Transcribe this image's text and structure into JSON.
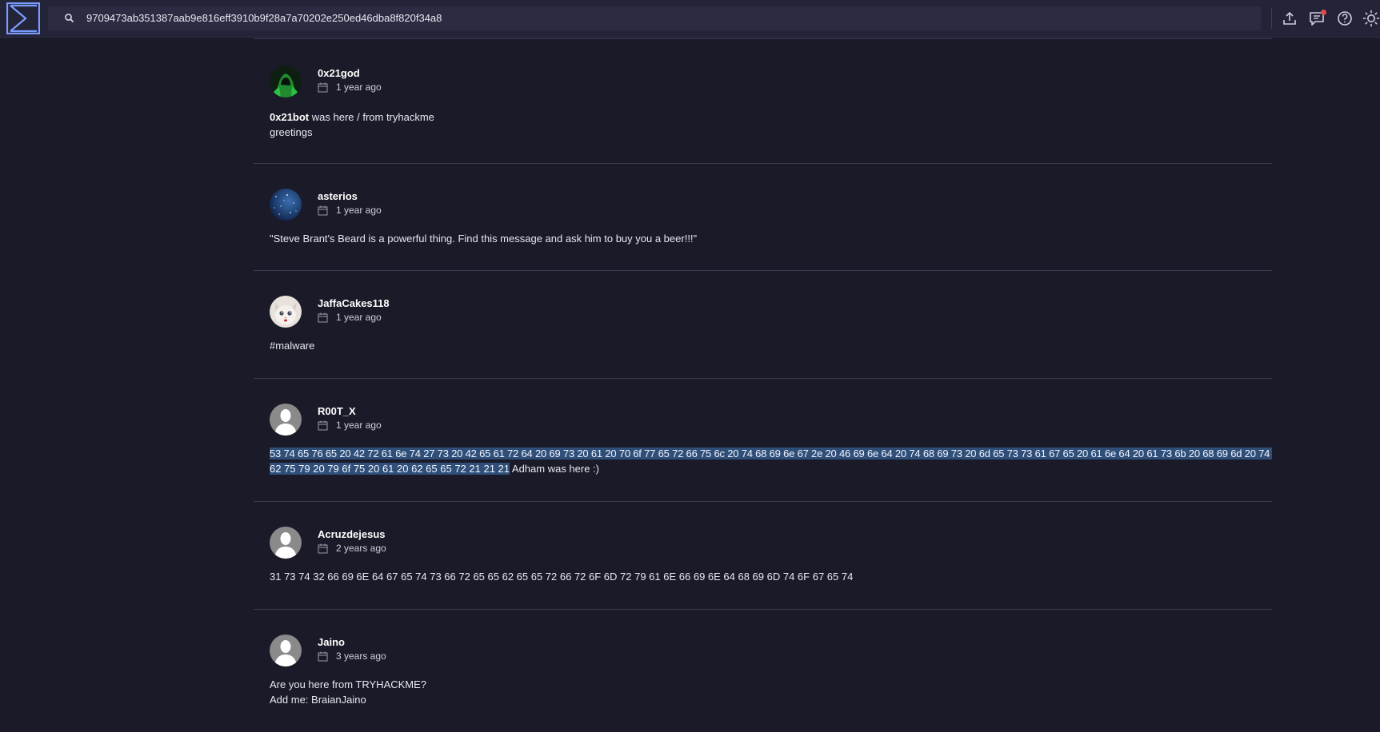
{
  "search": {
    "value": "9709473ab351387aab9e816eff3910b9f28a7a70202e250ed46dba8f820f34a8"
  },
  "topbar": {
    "icons": [
      "upload-icon",
      "comments-icon",
      "help-icon",
      "theme-icon"
    ],
    "notification": true
  },
  "colors": {
    "background": "#1a1a28",
    "topbar": "#232438",
    "accent": "#7b9cff",
    "highlight": "#2f4f78",
    "notification": "#e5484d"
  },
  "comments": [
    {
      "author": "0x21god",
      "date": "1 year ago",
      "avatar": "green-hooded-avatar",
      "bold_prefix": "0x21bot",
      "line1_rest": " was here / from tryhackme",
      "line2": "greetings"
    },
    {
      "author": "asterios",
      "date": "1 year ago",
      "avatar": "blue-starfield-avatar",
      "line1": "\"Steve Brant's Beard is a powerful thing. Find this message and ask him to buy you a beer!!!\""
    },
    {
      "author": "JaffaCakes118",
      "date": "1 year ago",
      "avatar": "white-cat-avatar",
      "line1": "#malware"
    },
    {
      "author": "R00T_X",
      "date": "1 year ago",
      "avatar": "default-person-avatar",
      "highlight_line1": "53 74 65 76 65 20 42 72 61 6e 74 27 73 20 42 65 61 72 64 20 69 73 20 61 20 70 6f 77 65 72 66 75 6c 20 74 68 69 6e 67 2e 20 46 69 6e 64 20 74 68 69 73 20 6d 65 73 73 61 67 65 20 61 6e 64 20 61 73 6b 20 68 69 6d 20 74 6f 20",
      "highlight_line2": "62 75 79 20 79 6f 75 20 61 20 62 65 65 72 21 21 21",
      "plain_suffix": " Adham was here :)"
    },
    {
      "author": "Acruzdejesus",
      "date": "2 years ago",
      "avatar": "default-person-avatar",
      "line1": "31 73 74 32 66 69 6E 64 67 65 74 73 66 72 65 65 62 65 65 72 66 72 6F 6D 72 79 61 6E 66 69 6E 64 68 69 6D 74 6F 67 65 74"
    },
    {
      "author": "Jaino",
      "date": "3 years ago",
      "avatar": "default-person-avatar",
      "line1": "Are you here from TRYHACKME?",
      "line2": "Add me: BraianJaino"
    }
  ]
}
